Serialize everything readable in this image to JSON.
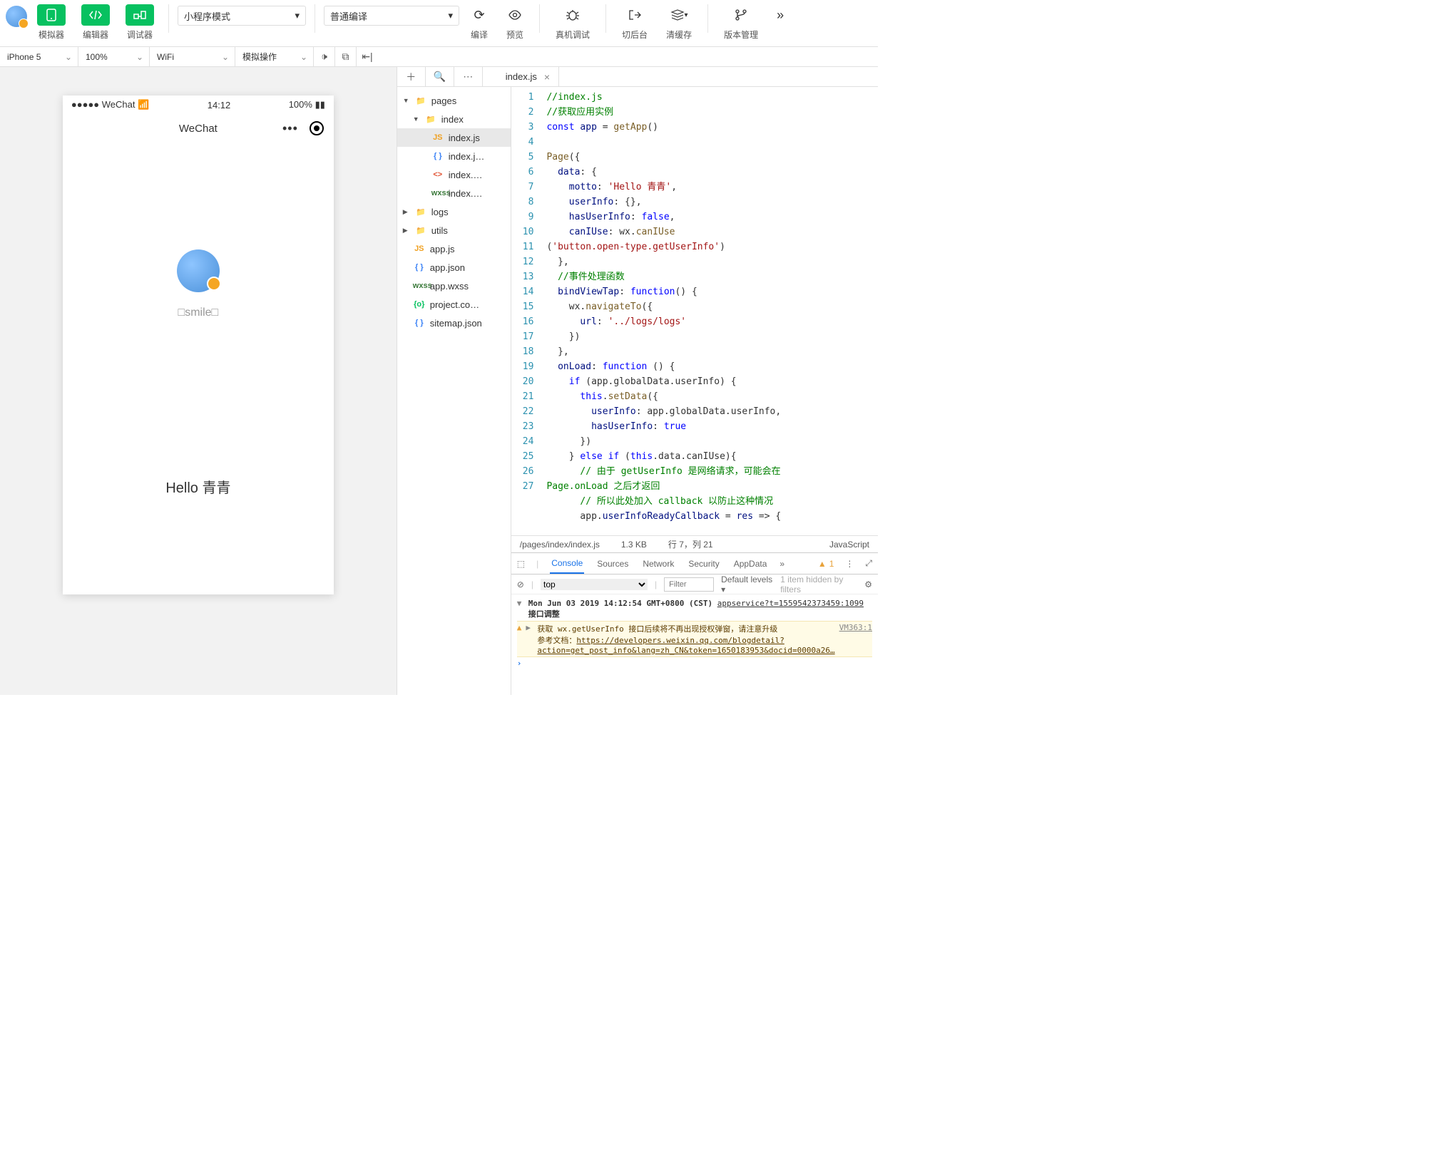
{
  "topbar": {
    "simulator": "模拟器",
    "editor": "编辑器",
    "debugger": "调试器",
    "modeSelect": "小程序模式",
    "compileSelect": "普通编译",
    "compile": "编译",
    "preview": "预览",
    "realDevice": "真机调试",
    "background": "切后台",
    "clearCache": "清缓存",
    "version": "版本管理"
  },
  "secbar": {
    "device": "iPhone 5",
    "zoom": "100%",
    "network": "WiFi",
    "simOp": "模拟操作"
  },
  "phone": {
    "carrier": "●●●●● WeChat",
    "time": "14:12",
    "battery": "100%",
    "navTitle": "WeChat",
    "nickname": "□smile□",
    "motto": "Hello 青青"
  },
  "editorTab": "index.js",
  "tree": {
    "pages": "pages",
    "index": "index",
    "indexjs": "index.js",
    "indexjson": "index.j…",
    "indexwxml": "index.…",
    "indexwxss": "index.…",
    "logs": "logs",
    "utils": "utils",
    "appjs": "app.js",
    "appjson": "app.json",
    "appwxss": "app.wxss",
    "project": "project.co…",
    "sitemap": "sitemap.json"
  },
  "status": {
    "path": "/pages/index/index.js",
    "size": "1.3 KB",
    "pos": "行 7，列 21",
    "lang": "JavaScript"
  },
  "devtools": {
    "tabs": [
      "Console",
      "Sources",
      "Network",
      "Security",
      "AppData"
    ],
    "warnCount": "1",
    "context": "top",
    "filterPlaceholder": "Filter",
    "levels": "Default levels ▾",
    "hidden": "1 item hidden by filters",
    "logTime": "Mon Jun 03 2019 14:12:54 GMT+0800 (CST)",
    "logLink": "appservice?t=1559542373459:1099",
    "logTitle": "接口调整",
    "warnSource": "VM363:1",
    "warnText": "获取 wx.getUserInfo 接口后续将不再出现授权弹窗，请注意升级",
    "warnDoc": "参考文档：",
    "warnUrl": "https://developers.weixin.qq.com/blogdetail?action=get_post_info&lang=zh_CN&token=1650183953&docid=0000a26…"
  },
  "code": {
    "lines": [
      {
        "n": 1,
        "html": "<span class='c-com'>//index.js</span>"
      },
      {
        "n": 2,
        "html": "<span class='c-com'>//获取应用实例</span>"
      },
      {
        "n": 3,
        "html": "<span class='c-kw'>const</span> <span class='c-id'>app</span> = <span class='c-fn'>getApp</span>()"
      },
      {
        "n": 4,
        "html": ""
      },
      {
        "n": 5,
        "html": "<span class='c-fn'>Page</span>({"
      },
      {
        "n": 6,
        "html": "  <span class='c-id'>data</span>: {"
      },
      {
        "n": 7,
        "html": "    <span class='c-id'>motto</span>: <span class='c-str'>'Hello 青青'</span>,"
      },
      {
        "n": 8,
        "html": "    <span class='c-id'>userInfo</span>: {},"
      },
      {
        "n": 9,
        "html": "    <span class='c-id'>hasUserInfo</span>: <span class='c-lit'>false</span>,"
      },
      {
        "n": 10,
        "html": "    <span class='c-id'>canIUse</span>: wx.<span class='c-fn'>canIUse</span>"
      },
      {
        "n": "",
        "html": "(<span class='c-str'>'button.open-type.getUserInfo'</span>)"
      },
      {
        "n": 11,
        "html": "  },"
      },
      {
        "n": 12,
        "html": "  <span class='c-com'>//事件处理函数</span>"
      },
      {
        "n": 13,
        "html": "  <span class='c-id'>bindViewTap</span>: <span class='c-kw'>function</span>() {"
      },
      {
        "n": 14,
        "html": "    wx.<span class='c-fn'>navigateTo</span>({"
      },
      {
        "n": 15,
        "html": "      <span class='c-id'>url</span>: <span class='c-str'>'../logs/logs'</span>"
      },
      {
        "n": 16,
        "html": "    })"
      },
      {
        "n": 17,
        "html": "  },"
      },
      {
        "n": 18,
        "html": "  <span class='c-id'>onLoad</span>: <span class='c-kw'>function</span> () {"
      },
      {
        "n": 19,
        "html": "    <span class='c-kw'>if</span> (app.globalData.userInfo) {"
      },
      {
        "n": 20,
        "html": "      <span class='c-kw'>this</span>.<span class='c-fn'>setData</span>({"
      },
      {
        "n": 21,
        "html": "        <span class='c-id'>userInfo</span>: app.globalData.userInfo,"
      },
      {
        "n": 22,
        "html": "        <span class='c-id'>hasUserInfo</span>: <span class='c-lit'>true</span>"
      },
      {
        "n": 23,
        "html": "      })"
      },
      {
        "n": 24,
        "html": "    } <span class='c-kw'>else</span> <span class='c-kw'>if</span> (<span class='c-kw'>this</span>.data.canIUse){"
      },
      {
        "n": 25,
        "html": "      <span class='c-com'>// 由于 getUserInfo 是网络请求，可能会在</span>"
      },
      {
        "n": "",
        "html": "<span class='c-com'>Page.onLoad 之后才返回</span>"
      },
      {
        "n": 26,
        "html": "      <span class='c-com'>// 所以此处加入 callback 以防止这种情况</span>"
      },
      {
        "n": 27,
        "html": "      app.<span class='c-id'>userInfoReadyCallback</span> = <span class='c-id'>res</span> =&gt; {"
      }
    ]
  }
}
